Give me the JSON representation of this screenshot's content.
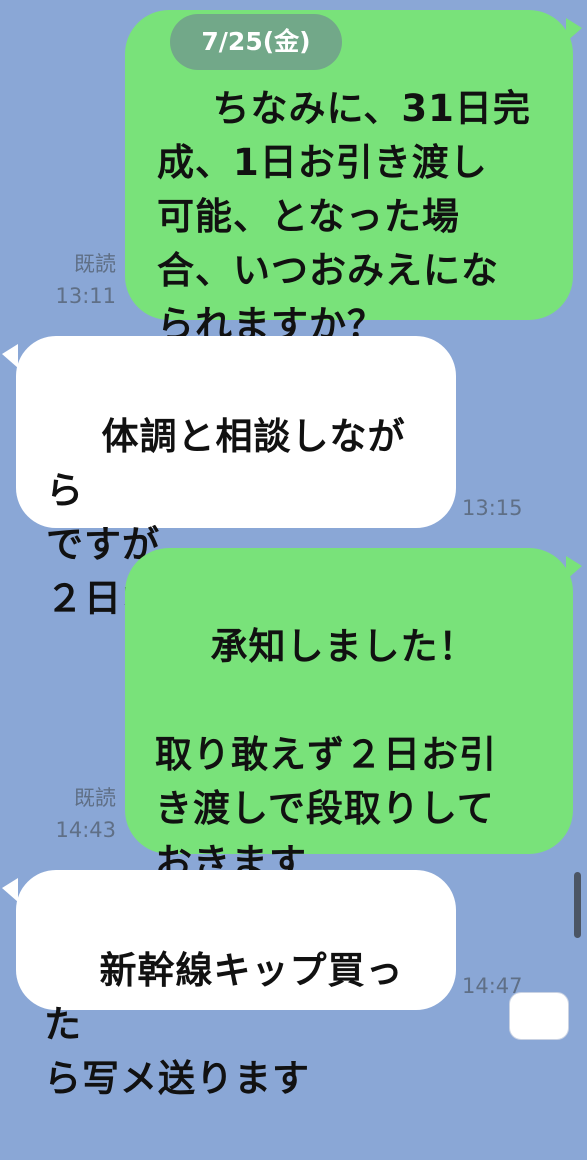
{
  "date_label": "7/25(金)",
  "messages": [
    {
      "side": "out",
      "text": "ちなみに、31日完\n成、1日お引き渡し\n可能、となった場\n合、いつおみえにな\nられますか？",
      "read": "既読",
      "time": "13:11"
    },
    {
      "side": "in",
      "text": "体調と相談しながら\nですが\n２日なら",
      "time": "13:15"
    },
    {
      "side": "out",
      "text": "承知しました！\n\n取り敢えず２日お引\nき渡しで段取りして\nおきます",
      "read": "既読",
      "time": "14:43"
    },
    {
      "side": "in",
      "text": "新幹線キップ買った\nら写メ送ります",
      "time": "14:47"
    }
  ],
  "colors": {
    "background": "#8aa7d6",
    "outgoing_bubble": "#79e27a",
    "incoming_bubble": "#ffffff",
    "meta_text": "#5f6f86"
  }
}
